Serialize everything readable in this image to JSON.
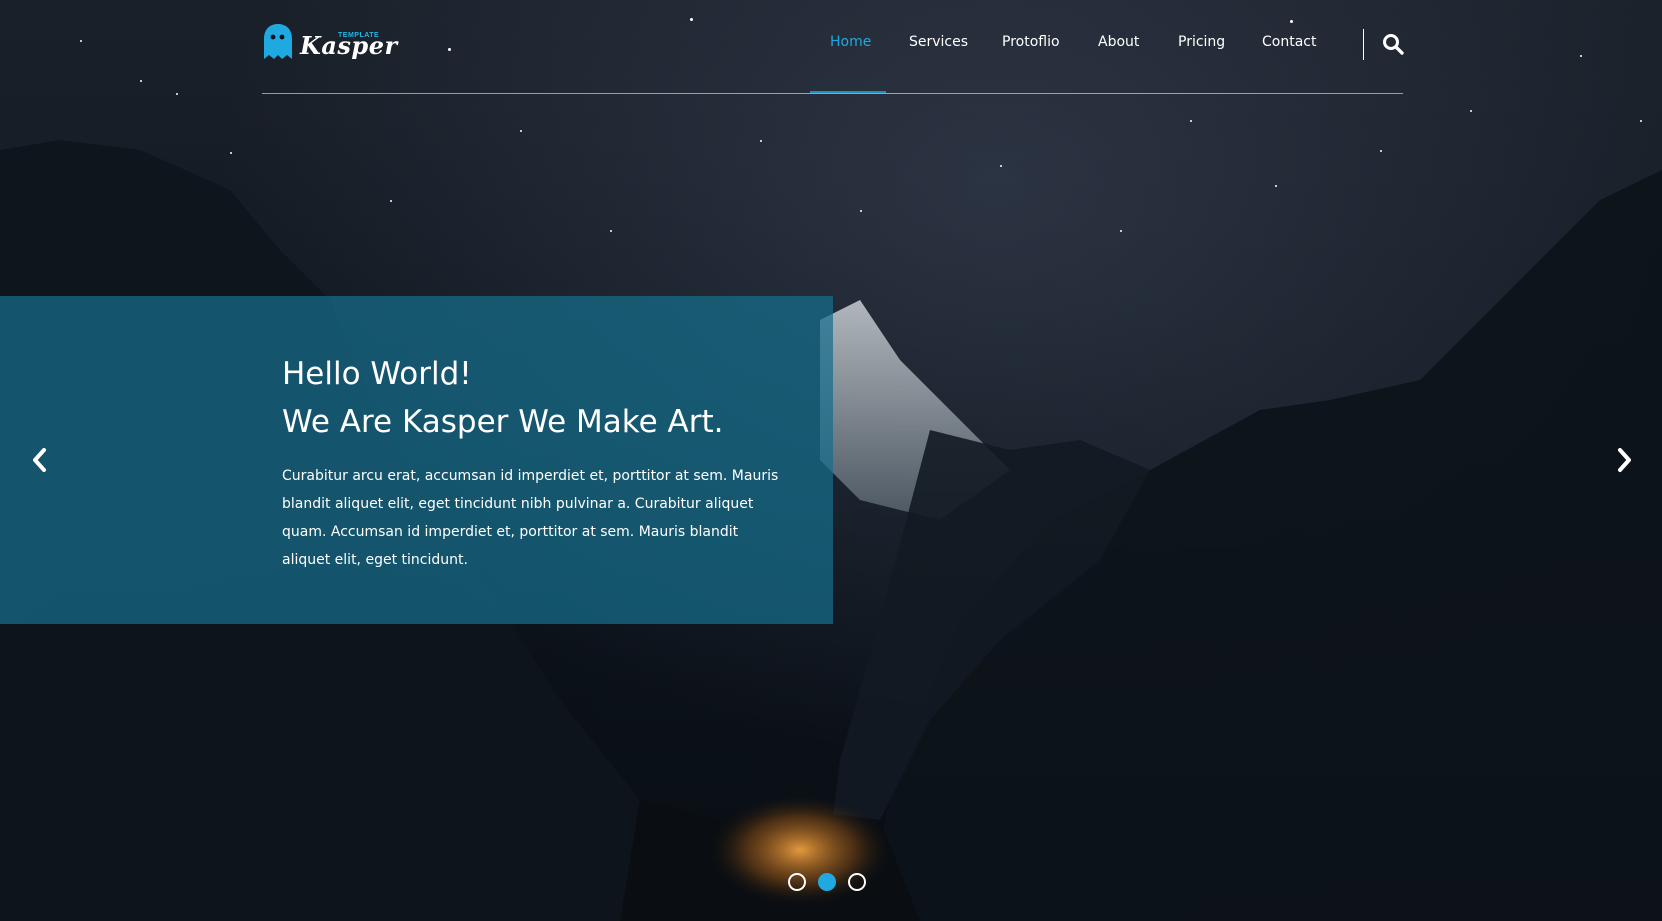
{
  "brand": {
    "tag": "TEMPLATE",
    "name": "Kasper",
    "accent_color": "#1fa9e0"
  },
  "nav": {
    "items": [
      {
        "label": "Home",
        "active": true
      },
      {
        "label": "Services",
        "active": false
      },
      {
        "label": "Protoflio",
        "active": false
      },
      {
        "label": "About",
        "active": false
      },
      {
        "label": "Pricing",
        "active": false
      },
      {
        "label": "Contact",
        "active": false
      }
    ],
    "search_icon": "search-icon"
  },
  "slide": {
    "title_line1": "Hello World!",
    "title_line2": "We Are Kasper We Make Art.",
    "text": "Curabitur arcu erat, accumsan id imperdiet et, porttitor at sem. Mauris blandit aliquet elit, eget tincidunt nibh pulvinar a. Curabitur aliquet quam. Accumsan id imperdiet et, porttitor at sem. Mauris blandit aliquet elit, eget tincidunt.",
    "box_color": "#166e8c"
  },
  "slider": {
    "prev_icon": "chevron-left-icon",
    "next_icon": "chevron-right-icon",
    "bullet_count": 3,
    "active_bullet": 2
  }
}
